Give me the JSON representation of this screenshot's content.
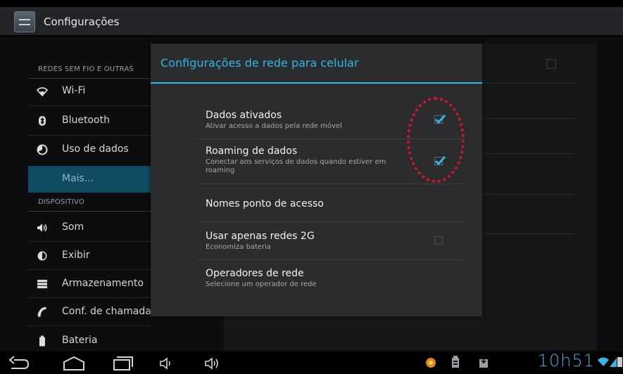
{
  "actionbar": {
    "title": "Configurações"
  },
  "sidebar": {
    "section_wireless": "REDES SEM FIO E OUTRAS",
    "section_device": "DISPOSITIVO",
    "items": [
      {
        "label": "Wi-Fi",
        "icon": "wifi-icon"
      },
      {
        "label": "Bluetooth",
        "icon": "bluetooth-icon"
      },
      {
        "label": "Uso de dados",
        "icon": "data-usage-icon"
      },
      {
        "label": "Mais...",
        "icon": ""
      },
      {
        "label": "Som",
        "icon": "speaker-icon"
      },
      {
        "label": "Exibir",
        "icon": "brightness-icon"
      },
      {
        "label": "Armazenamento",
        "icon": "storage-icon"
      },
      {
        "label": "Conf. de chamada",
        "icon": "phone-icon"
      },
      {
        "label": "Bateria",
        "icon": "battery-icon"
      }
    ]
  },
  "dialog": {
    "title": "Configurações de rede para celular",
    "options": [
      {
        "title": "Dados ativados",
        "subtitle": "Ativar acesso a dados pela rede móvel",
        "checked": true
      },
      {
        "title": "Roaming de dados",
        "subtitle": "Conectar aos serviços de dados quando estiver em roaming",
        "checked": true
      },
      {
        "title": "Nomes ponto de acesso",
        "subtitle": ""
      },
      {
        "title": "Usar apenas redes 2G",
        "subtitle": "Economiza bateria",
        "checked": false
      },
      {
        "title": "Operadores de rede",
        "subtitle": "Selecione um operador de rede"
      }
    ]
  },
  "statusbar": {
    "clock": "10h51"
  },
  "colors": {
    "accent": "#33b5e5",
    "highlight": "#e0102a",
    "active_item": "#114a63"
  }
}
